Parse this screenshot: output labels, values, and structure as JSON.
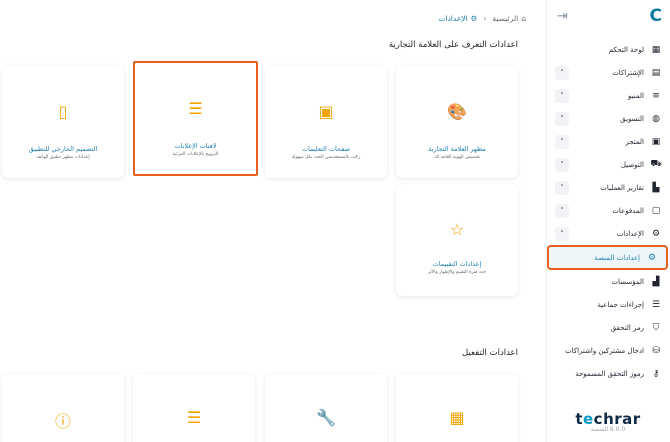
{
  "sidebar": {
    "logo": "C",
    "items": [
      {
        "label": "لوحة التحكم",
        "icon": "dashboard-icon",
        "glyph": "▦",
        "has_chevron": false
      },
      {
        "label": "الإشتراكات",
        "icon": "subscriptions-icon",
        "glyph": "▤",
        "has_chevron": true
      },
      {
        "label": "المنيو",
        "icon": "menu-icon",
        "glyph": "≡",
        "has_chevron": true
      },
      {
        "label": "التسويق",
        "icon": "globe-icon",
        "glyph": "◍",
        "has_chevron": true
      },
      {
        "label": "المتجر",
        "icon": "store-icon",
        "glyph": "▣",
        "has_chevron": true
      },
      {
        "label": "التوصيل",
        "icon": "car-icon",
        "glyph": "⛟",
        "has_chevron": true
      },
      {
        "label": "تقارير العمليات",
        "icon": "report-icon",
        "glyph": "▙",
        "has_chevron": true
      },
      {
        "label": "المدفوعات",
        "icon": "wallet-icon",
        "glyph": "▢",
        "has_chevron": true
      },
      {
        "label": "الإعدادات",
        "icon": "gear-icon",
        "glyph": "⚙",
        "has_chevron": true,
        "expanded": true
      },
      {
        "label": "إعدادات المنصة",
        "icon": "platform-settings-icon",
        "glyph": "⚙",
        "has_chevron": false,
        "active": true
      },
      {
        "label": "المؤسسات",
        "icon": "institutions-icon",
        "glyph": "▟",
        "has_chevron": false
      },
      {
        "label": "إجراءات جماعية",
        "icon": "list-icon",
        "glyph": "☰",
        "has_chevron": false
      },
      {
        "label": "رمز التحقق",
        "icon": "shield-icon",
        "glyph": "⛉",
        "has_chevron": false
      },
      {
        "label": "ادخال مشتركين واشتراكات",
        "icon": "database-icon",
        "glyph": "⛁",
        "has_chevron": false
      },
      {
        "label": "رموز التحقق المسموحة",
        "icon": "key-icon",
        "glyph": "⚷",
        "has_chevron": false
      }
    ],
    "brand": {
      "part1": "t",
      "part2": "e",
      "part3": "chrar"
    },
    "version": "8.0.0 المنصة"
  },
  "breadcrumb": {
    "home": "الرئيسية",
    "current": "الإعدادات"
  },
  "sections": {
    "brand_title": "اعدادات التعرف على العلامة التجارية",
    "activation_title": "اعدادات التفعيل"
  },
  "cards": [
    {
      "title": "مظهر العلامة التجارية",
      "subtitle": "تخصيص الهوية العامة لك",
      "icon": "palette-icon",
      "glyph": "🎨"
    },
    {
      "title": "صفحات التعليمات",
      "subtitle": "رحّب بالمستخدمين الجدد بكل سهولة",
      "icon": "images-icon",
      "glyph": "▣"
    },
    {
      "title": "لافتات الإعلانات",
      "subtitle": "الترويج بالإعلانات المرئية",
      "icon": "banner-icon",
      "glyph": "☰"
    },
    {
      "title": "التصميم الخارجي للتطبيق",
      "subtitle": "إعدادات مظهر تطبيق الهاتف",
      "icon": "phone-icon",
      "glyph": "▯"
    },
    {
      "title": "إعدادات التقييمات",
      "subtitle": "حدد فترة التقييم والإظهار والأثر",
      "icon": "star-icon",
      "glyph": "☆"
    }
  ],
  "activation_cards": [
    {
      "icon": "qr-add-icon",
      "glyph": "▦"
    },
    {
      "icon": "wrench-icon",
      "glyph": "🔧"
    },
    {
      "icon": "list-icon",
      "glyph": "☰"
    },
    {
      "icon": "alert-icon",
      "glyph": "ⓘ"
    }
  ]
}
